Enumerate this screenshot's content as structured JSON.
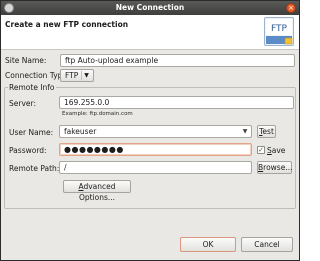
{
  "window": {
    "title": "New Connection"
  },
  "header": {
    "heading": "Create a new FTP connection",
    "logo_text": "FTP"
  },
  "site_name": {
    "label": "Site Name:",
    "value": "ftp Auto-upload example"
  },
  "connection_type": {
    "label": "Connection Type:",
    "value": "FTP"
  },
  "remote_info": {
    "legend": "Remote Info",
    "server": {
      "label": "Server:",
      "value": "169.255.0.0",
      "hint": "Example: ftp.domain.com"
    },
    "user_name": {
      "label": "User Name:",
      "value": "fakeuser",
      "test_label": "Test"
    },
    "password": {
      "label": "Password:",
      "value": "●●●●●●●●",
      "save_label": "Save",
      "save_checked": true
    },
    "remote_path": {
      "label": "Remote Path:",
      "value": "/",
      "browse_label": "Browse..."
    },
    "advanced_label": "Advanced Options..."
  },
  "footer": {
    "ok_label": "OK",
    "cancel_label": "Cancel"
  },
  "colors": {
    "titlebar": "#4a4a48",
    "dialog_bg": "#e9e8e4",
    "close_button": "#e25b27",
    "focus_border": "#e3a48a",
    "ftp_logo_bg": "#5b8cc8"
  }
}
